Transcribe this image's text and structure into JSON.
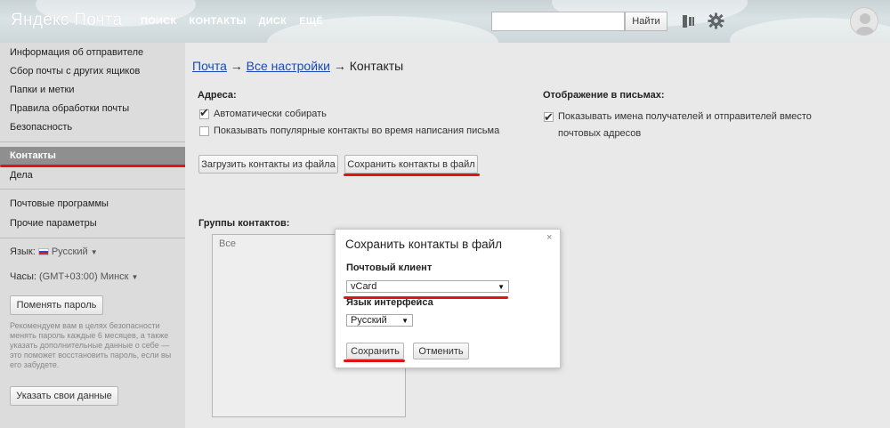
{
  "header": {
    "logo": "Яндекс Почта",
    "nav": [
      "ПОИСК",
      "КОНТАКТЫ",
      "ДИСК",
      "ЕЩЁ"
    ],
    "search": {
      "placeholder": "",
      "button_label": "Найти"
    },
    "icons": [
      "sidebar-toggle-icon",
      "gear-icon",
      "avatar-icon"
    ]
  },
  "sidebar": {
    "items": [
      "Информация об отправителе",
      "Сбор почты с других ящиков",
      "Папки и метки",
      "Правила обработки почты",
      "Безопасность",
      "Контакты",
      "Дела",
      "Почтовые программы",
      "Прочие параметры"
    ],
    "active_item": "Контакты",
    "language_label": "Язык:",
    "language_value": "Русский",
    "timezone_label": "Часы:",
    "timezone_value": "(GMT+03:00) Минск",
    "change_password_button": "Поменять пароль",
    "hint": "Рекомендуем вам в целях безопасности менять пароль каждые 6 месяцев, а также указать дополнительные данные о себе — это поможет восстановить пароль, если вы его забудете.",
    "your_data_button": "Указать свои данные"
  },
  "main": {
    "breadcrumb": {
      "mail": "Почта",
      "arrow1": "→",
      "all_settings": "Все настройки",
      "arrow2": "→",
      "current": "Контакты"
    },
    "addresses": {
      "title": "Адреса:",
      "auto_collect": {
        "label": "Автоматически собирать",
        "checked": true
      },
      "show_popular": {
        "label": "Показывать популярные контакты во время написания письма",
        "checked": false
      }
    },
    "display": {
      "title": "Отображение в письмах:",
      "show_names": {
        "label": "Показывать имена получателей и отправителей вместо почтовых адресов",
        "checked": true
      }
    },
    "upload_button": "Загрузить контакты из файла",
    "save_button": "Сохранить контакты в файл",
    "groups_title": "Группы контактов:",
    "groups_all": "Все"
  },
  "dialog": {
    "title": "Сохранить контакты в файл",
    "close": "×",
    "client_label": "Почтовый клиент",
    "client_value": "vCard",
    "language_label": "Язык интерфейса",
    "language_value": "Русский",
    "save": "Сохранить",
    "cancel": "Отменить"
  },
  "colors": {
    "accent_red": "#e11414",
    "link": "#1a4ab5",
    "active_sidebar": "#8f8f8f"
  }
}
